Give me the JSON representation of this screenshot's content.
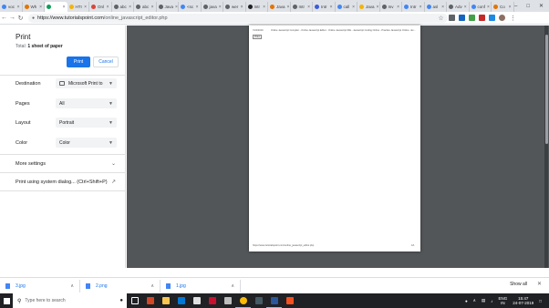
{
  "tabs": [
    {
      "label": "voc",
      "color": "#4285f4"
    },
    {
      "label": "Wh",
      "color": "#e37400"
    },
    {
      "label": "",
      "color": "#0f9d58",
      "active": true
    },
    {
      "label": "HTI",
      "color": "#f4b400"
    },
    {
      "label": "Onl",
      "color": "#db4437"
    },
    {
      "label": "abc",
      "color": "#5f6368"
    },
    {
      "label": "abc",
      "color": "#5f6368"
    },
    {
      "label": "Java",
      "color": "#5f6368"
    },
    {
      "label": "<sc",
      "color": "#4285f4"
    },
    {
      "label": "java",
      "color": "#5f6368"
    },
    {
      "label": "wer",
      "color": "#5f6368"
    },
    {
      "label": "Intr",
      "color": "#202124"
    },
    {
      "label": "Java",
      "color": "#e37400"
    },
    {
      "label": "Intr",
      "color": "#5f6368"
    },
    {
      "label": "Intr",
      "color": "#3b5bdb"
    },
    {
      "label": "call",
      "color": "#4285f4"
    },
    {
      "label": "Java",
      "color": "#f4b400"
    },
    {
      "label": "Inv",
      "color": "#5f6368"
    },
    {
      "label": "Intr",
      "color": "#4285f4"
    },
    {
      "label": "asl",
      "color": "#4285f4"
    },
    {
      "label": "Adv",
      "color": "#5f6368"
    },
    {
      "label": "conf",
      "color": "#4285f4"
    },
    {
      "label": "Co",
      "color": "#e37400"
    }
  ],
  "browser": {
    "new_tab": "+",
    "url_host": "https://www.tutorialspoint.com",
    "url_path": "/online_javascript_editor.php"
  },
  "print": {
    "title": "Print",
    "total_label": "Total:",
    "total_value": "1 sheet of paper",
    "print_button": "Print",
    "cancel_button": "Cancel",
    "destination_label": "Destination",
    "destination_value": "Microsoft Print to",
    "pages_label": "Pages",
    "pages_value": "All",
    "layout_label": "Layout",
    "layout_value": "Portrait",
    "color_label": "Color",
    "color_value": "Color",
    "more_settings": "More settings",
    "system_dialog": "Print using system dialog... (Ctrl+Shift+P)"
  },
  "preview": {
    "header_date": "7/24/2019",
    "header_title": "Online Javascript Compiler - Online Javascript Editor - Online Javascript IDE - Javascript Coding Online - Practice Javascript Online - Ex...",
    "print_button": "Print",
    "footer_url": "https://www.tutorialspoint.com/online_javascript_editor.php",
    "footer_page": "1/1"
  },
  "downloads": [
    {
      "name": "3.jpg"
    },
    {
      "name": "2.png"
    },
    {
      "name": "1.jpg"
    }
  ],
  "shelf": {
    "show_all": "Show all"
  },
  "taskbar": {
    "search_placeholder": "Type here to search",
    "lang_top": "ENG",
    "lang_bottom": "IN",
    "time": "15:47",
    "date": "24-07-2019"
  }
}
